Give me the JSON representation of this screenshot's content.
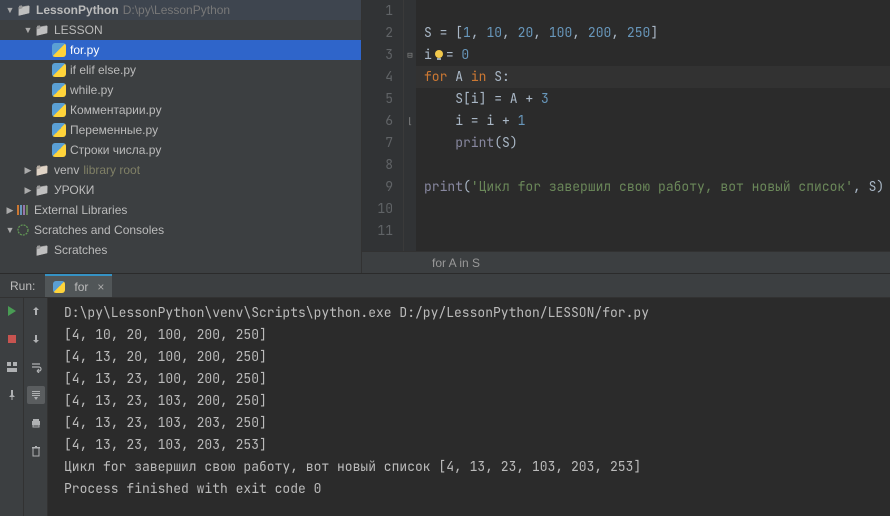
{
  "project": {
    "name": "LessonPython",
    "path": "D:\\py\\LessonPython",
    "lesson_folder": "LESSON",
    "files": [
      {
        "name": "for.py",
        "selected": true
      },
      {
        "name": "if elif else.py"
      },
      {
        "name": "while.py"
      },
      {
        "name": "Комментарии.py"
      },
      {
        "name": "Переменные.py"
      },
      {
        "name": "Строки числа.py"
      }
    ],
    "venv": {
      "name": "venv",
      "hint": "library root"
    },
    "lessons2": "УРОКИ",
    "external": "External Libraries",
    "scratches": "Scratches and Consoles",
    "scratches_child": "Scratches"
  },
  "editor": {
    "lines": {
      "l1_a": "S = [",
      "l1_b": "1",
      "l1_c": ", ",
      "l1_d": "10",
      "l1_e": ", ",
      "l1_f": "20",
      "l1_g": ", ",
      "l1_h": "100",
      "l1_i": ", ",
      "l1_j": "200",
      "l1_k": ", ",
      "l1_l": "250",
      "l1_m": "]",
      "l2_a": "i",
      "l2_b": "= ",
      "l2_c": "0",
      "l3_a": "for ",
      "l3_b": "A ",
      "l3_c": "in ",
      "l3_d": "S:",
      "l4_a": "    S[i] = A + ",
      "l4_b": "3",
      "l5_a": "    i = i + ",
      "l5_b": "1",
      "l6_a": "    ",
      "l6_b": "print",
      "l6_c": "(S)",
      "l8_a": "print",
      "l8_b": "(",
      "l8_c": "'Цикл for завершил свою работу, вот новый список'",
      "l8_d": ", S)"
    },
    "gutter": [
      "1",
      "2",
      "3",
      "4",
      "5",
      "6",
      "7",
      "8",
      "9",
      "10",
      "11"
    ],
    "breadcrumb": "for A in S"
  },
  "run": {
    "label": "Run:",
    "tab": "for",
    "output": [
      "D:\\py\\LessonPython\\venv\\Scripts\\python.exe D:/py/LessonPython/LESSON/for.py",
      "[4, 10, 20, 100, 200, 250]",
      "[4, 13, 20, 100, 200, 250]",
      "[4, 13, 23, 100, 200, 250]",
      "[4, 13, 23, 103, 200, 250]",
      "[4, 13, 23, 103, 203, 250]",
      "[4, 13, 23, 103, 203, 253]",
      "Цикл for завершил свою работу, вот новый список [4, 13, 23, 103, 203, 253]",
      "",
      "Process finished with exit code 0"
    ]
  }
}
